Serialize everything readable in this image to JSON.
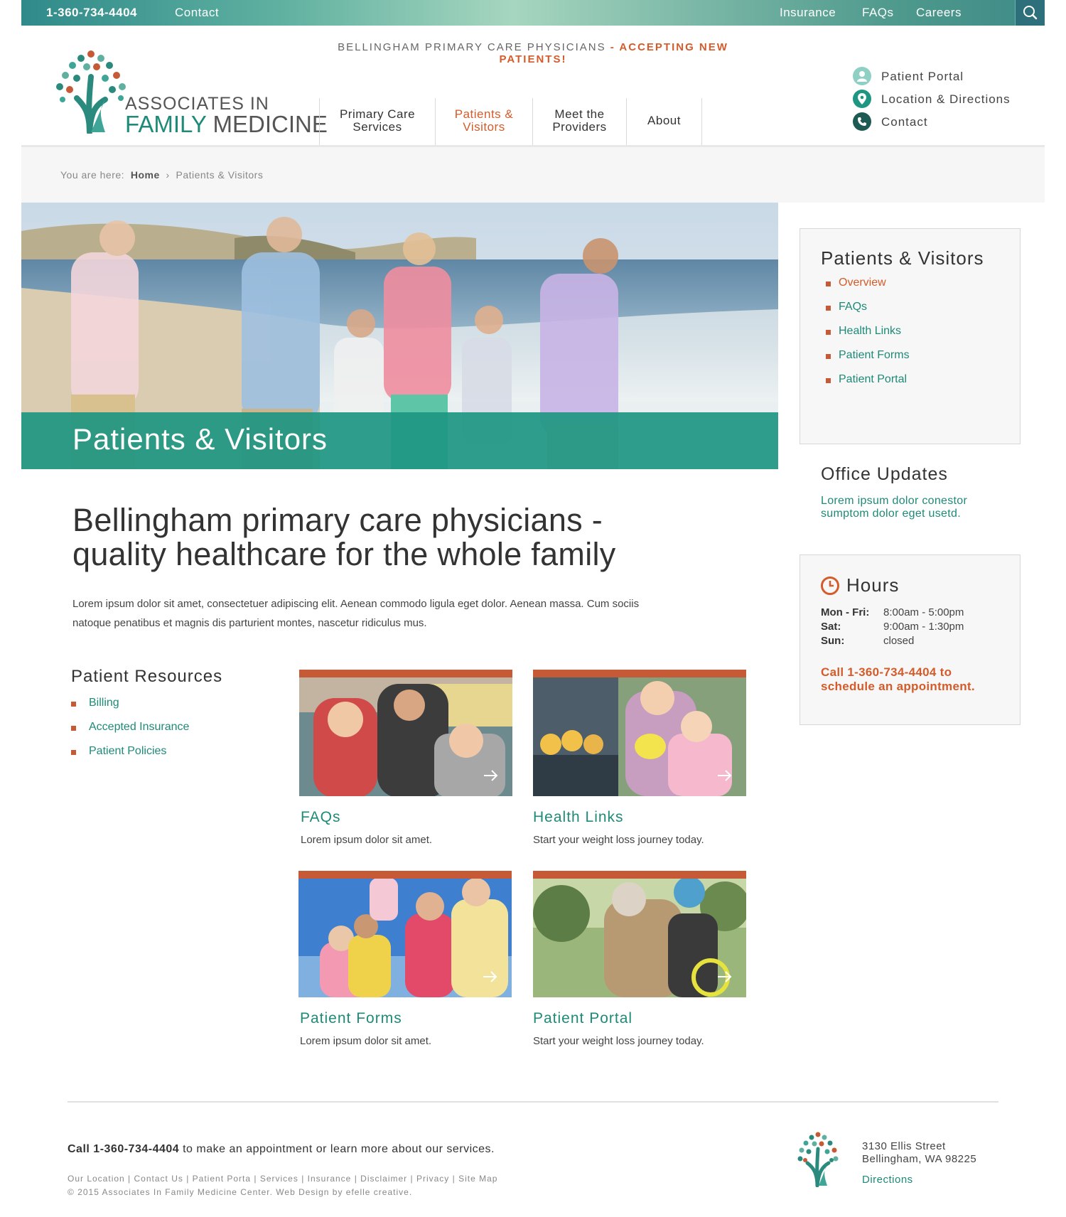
{
  "topbar": {
    "phone": "1-360-734-4404",
    "contact": "Contact",
    "links": [
      "Insurance",
      "FAQs",
      "Careers"
    ]
  },
  "tagline": {
    "main": "BELLINGHAM PRIMARY CARE PHYSICIANS",
    "sep": " - ",
    "highlight": "ACCEPTING NEW PATIENTS!"
  },
  "logo": {
    "line1": "ASSOCIATES IN",
    "line2a": "FAMILY",
    "line2b": "MEDICINE"
  },
  "nav": {
    "items": [
      {
        "line1": "Primary Care",
        "line2": "Services"
      },
      {
        "line1": "Patients &",
        "line2": "Visitors"
      },
      {
        "line1": "Meet the",
        "line2": "Providers"
      },
      {
        "line1": "About",
        "line2": ""
      }
    ]
  },
  "utility": {
    "portal": "Patient Portal",
    "location": "Location & Directions",
    "contact": "Contact"
  },
  "breadcrumb": {
    "prefix": "You are here:",
    "home": "Home",
    "sep": "›",
    "current": "Patients & Visitors"
  },
  "hero": {
    "title": "Patients & Visitors"
  },
  "main": {
    "heading_line1": "Bellingham primary care physicians -",
    "heading_line2": "quality healthcare for the whole family",
    "intro_line1": "Lorem ipsum dolor sit amet, consectetuer adipiscing elit. Aenean commodo ligula eget dolor. Aenean massa. Cum sociis",
    "intro_line2": "natoque penatibus et magnis dis parturient montes, nascetur ridiculus mus."
  },
  "resources": {
    "title": "Patient Resources",
    "items": [
      "Billing",
      "Accepted Insurance",
      "Patient Policies"
    ]
  },
  "cards": [
    {
      "title": "FAQs",
      "text": "Lorem ipsum dolor sit amet."
    },
    {
      "title": "Health Links",
      "text": "Start your weight loss journey today."
    },
    {
      "title": "Patient Forms",
      "text": "Lorem ipsum dolor sit amet."
    },
    {
      "title": "Patient Portal",
      "text": "Start your weight loss journey today."
    }
  ],
  "sidebar": {
    "title": "Patients & Visitors",
    "items": [
      "Overview",
      "FAQs",
      "Health Links",
      "Patient Forms",
      "Patient Portal"
    ],
    "active_index": 0,
    "updates_title": "Office Updates",
    "updates_line1": "Lorem ipsum dolor conestor",
    "updates_line2": "sumptom dolor eget usetd."
  },
  "hours": {
    "title": "Hours",
    "rows": [
      {
        "day": "Mon - Fri:",
        "time": "8:00am - 5:00pm"
      },
      {
        "day": "Sat:",
        "time": "9:00am - 1:30pm"
      },
      {
        "day": "Sun:",
        "time": "closed"
      }
    ],
    "cta_line1": "Call 1-360-734-4404 to",
    "cta_line2": "schedule an appointment."
  },
  "footer": {
    "call_bold": "Call 1-360-734-4404",
    "call_rest": " to make an appointment or learn more about our services.",
    "links": [
      "Our Location",
      "Contact Us",
      "Patient Porta",
      "Services",
      "Insurance",
      "Disclaimer",
      "Privacy",
      "Site Map"
    ],
    "copyright": "© 2015 Associates In Family Medicine Center. Web Design by efelle creative.",
    "address1": "3130 Ellis Street",
    "address2": "Bellingham, WA 98225",
    "directions": "Directions"
  },
  "colors": {
    "teal": "#1e8a78",
    "orange": "#d45b2a",
    "banner": "#1e9682",
    "rust": "#c65a36"
  }
}
